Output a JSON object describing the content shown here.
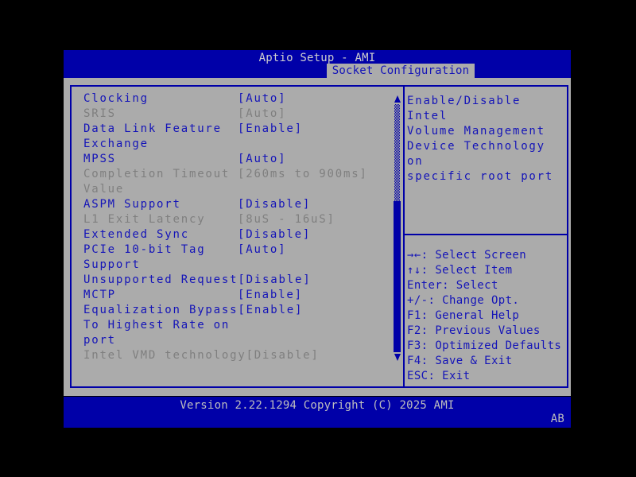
{
  "header": {
    "title": "Aptio Setup - AMI",
    "tab": "Socket Configuration"
  },
  "left_panel": {
    "items": [
      {
        "lines": [
          "Clocking"
        ],
        "value": "[Auto]",
        "grayed": false
      },
      {
        "lines": [
          "SRIS"
        ],
        "value": "[Auto]",
        "grayed": true
      },
      {
        "lines": [
          "Data Link Feature",
          "Exchange"
        ],
        "value": "[Enable]",
        "grayed": false
      },
      {
        "lines": [
          "MPSS"
        ],
        "value": "[Auto]",
        "grayed": false
      },
      {
        "lines": [
          "Completion Timeout",
          "Value"
        ],
        "value": "[260ms to 900ms]",
        "grayed": true
      },
      {
        "lines": [
          "ASPM Support"
        ],
        "value": "[Disable]",
        "grayed": false
      },
      {
        "lines": [
          "L1 Exit Latency"
        ],
        "value": "[8uS - 16uS]",
        "grayed": true
      },
      {
        "lines": [
          "Extended Sync"
        ],
        "value": "[Disable]",
        "grayed": false
      },
      {
        "lines": [
          "PCIe 10-bit Tag",
          "Support"
        ],
        "value": "[Auto]",
        "grayed": false
      },
      {
        "lines": [
          "Unsupported Request"
        ],
        "value": "[Disable]",
        "grayed": false
      },
      {
        "lines": [
          "MCTP"
        ],
        "value": "[Enable]",
        "grayed": false
      },
      {
        "lines": [
          "Equalization Bypass",
          "To Highest Rate on",
          "port"
        ],
        "value": "[Enable]",
        "grayed": false
      },
      {
        "lines": [
          "Intel VMD technology"
        ],
        "value": "[Disable]",
        "grayed": true
      }
    ],
    "scrollbar": {
      "up_icon": "scroll-up-arrow",
      "down_icon": "scroll-down-arrow"
    }
  },
  "right_panel": {
    "help_lines": [
      "Enable/Disable Intel",
      "Volume Management",
      "Device Technology on",
      "specific root port"
    ],
    "hotkeys": [
      {
        "key": "→←",
        "action": "Select Screen"
      },
      {
        "key": "↑↓",
        "action": "Select Item"
      },
      {
        "key": "Enter",
        "action": "Select"
      },
      {
        "key": "+/-",
        "action": "Change Opt."
      },
      {
        "key": "F1",
        "action": "General Help"
      },
      {
        "key": "F2",
        "action": "Previous Values"
      },
      {
        "key": "F3",
        "action": "Optimized Defaults"
      },
      {
        "key": "F4",
        "action": "Save & Exit"
      },
      {
        "key": "ESC",
        "action": "Exit"
      }
    ]
  },
  "footer": {
    "version": "Version 2.22.1294 Copyright (C) 2025 AMI",
    "code": "AB"
  },
  "colors": {
    "blue": "#0000A8",
    "text_blue": "#1414B8",
    "background_gray": "#ABABAB",
    "disabled_text": "#7F7F7F",
    "title_text": "#CFCFCF",
    "footer_text": "#BEBEBE",
    "outer_black": "#000000"
  }
}
